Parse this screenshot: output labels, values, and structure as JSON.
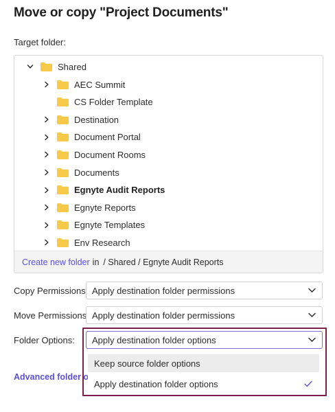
{
  "dialog": {
    "title": "Move or copy \"Project Documents\"",
    "target_label": "Target folder:"
  },
  "tree": {
    "root": {
      "label": "Shared",
      "expanded": true
    },
    "items": [
      {
        "label": "AEC Summit",
        "has_children": true,
        "bold": false
      },
      {
        "label": "CS Folder Template",
        "has_children": false,
        "bold": false
      },
      {
        "label": "Destination",
        "has_children": true,
        "bold": false
      },
      {
        "label": "Document Portal",
        "has_children": true,
        "bold": false
      },
      {
        "label": "Document Rooms",
        "has_children": true,
        "bold": false
      },
      {
        "label": "Documents",
        "has_children": true,
        "bold": false
      },
      {
        "label": "Egnyte Audit Reports",
        "has_children": true,
        "bold": true
      },
      {
        "label": "Egnyte Reports",
        "has_children": true,
        "bold": false
      },
      {
        "label": "Egnyte Templates",
        "has_children": true,
        "bold": false
      },
      {
        "label": "Env Research",
        "has_children": true,
        "bold": false
      }
    ],
    "footer": {
      "create_link": "Create new folder",
      "in_text": "in",
      "path": "/ Shared / Egnyte Audit Reports"
    }
  },
  "options": {
    "copy_permissions": {
      "label": "Copy Permissions:",
      "value": "Apply destination folder permissions"
    },
    "move_permissions": {
      "label": "Move Permissions:",
      "value": "Apply destination folder permissions"
    },
    "folder_options": {
      "label": "Folder Options:",
      "value": "Apply destination folder options"
    }
  },
  "dropdown": {
    "items": [
      {
        "label": "Keep source folder options",
        "selected": false
      },
      {
        "label": "Apply destination folder options",
        "selected": true
      }
    ]
  },
  "advanced_link": "Advanced folder o",
  "colors": {
    "accent": "#5b4fd6",
    "folder": "#f7c948",
    "highlight": "#7a1f4b"
  }
}
